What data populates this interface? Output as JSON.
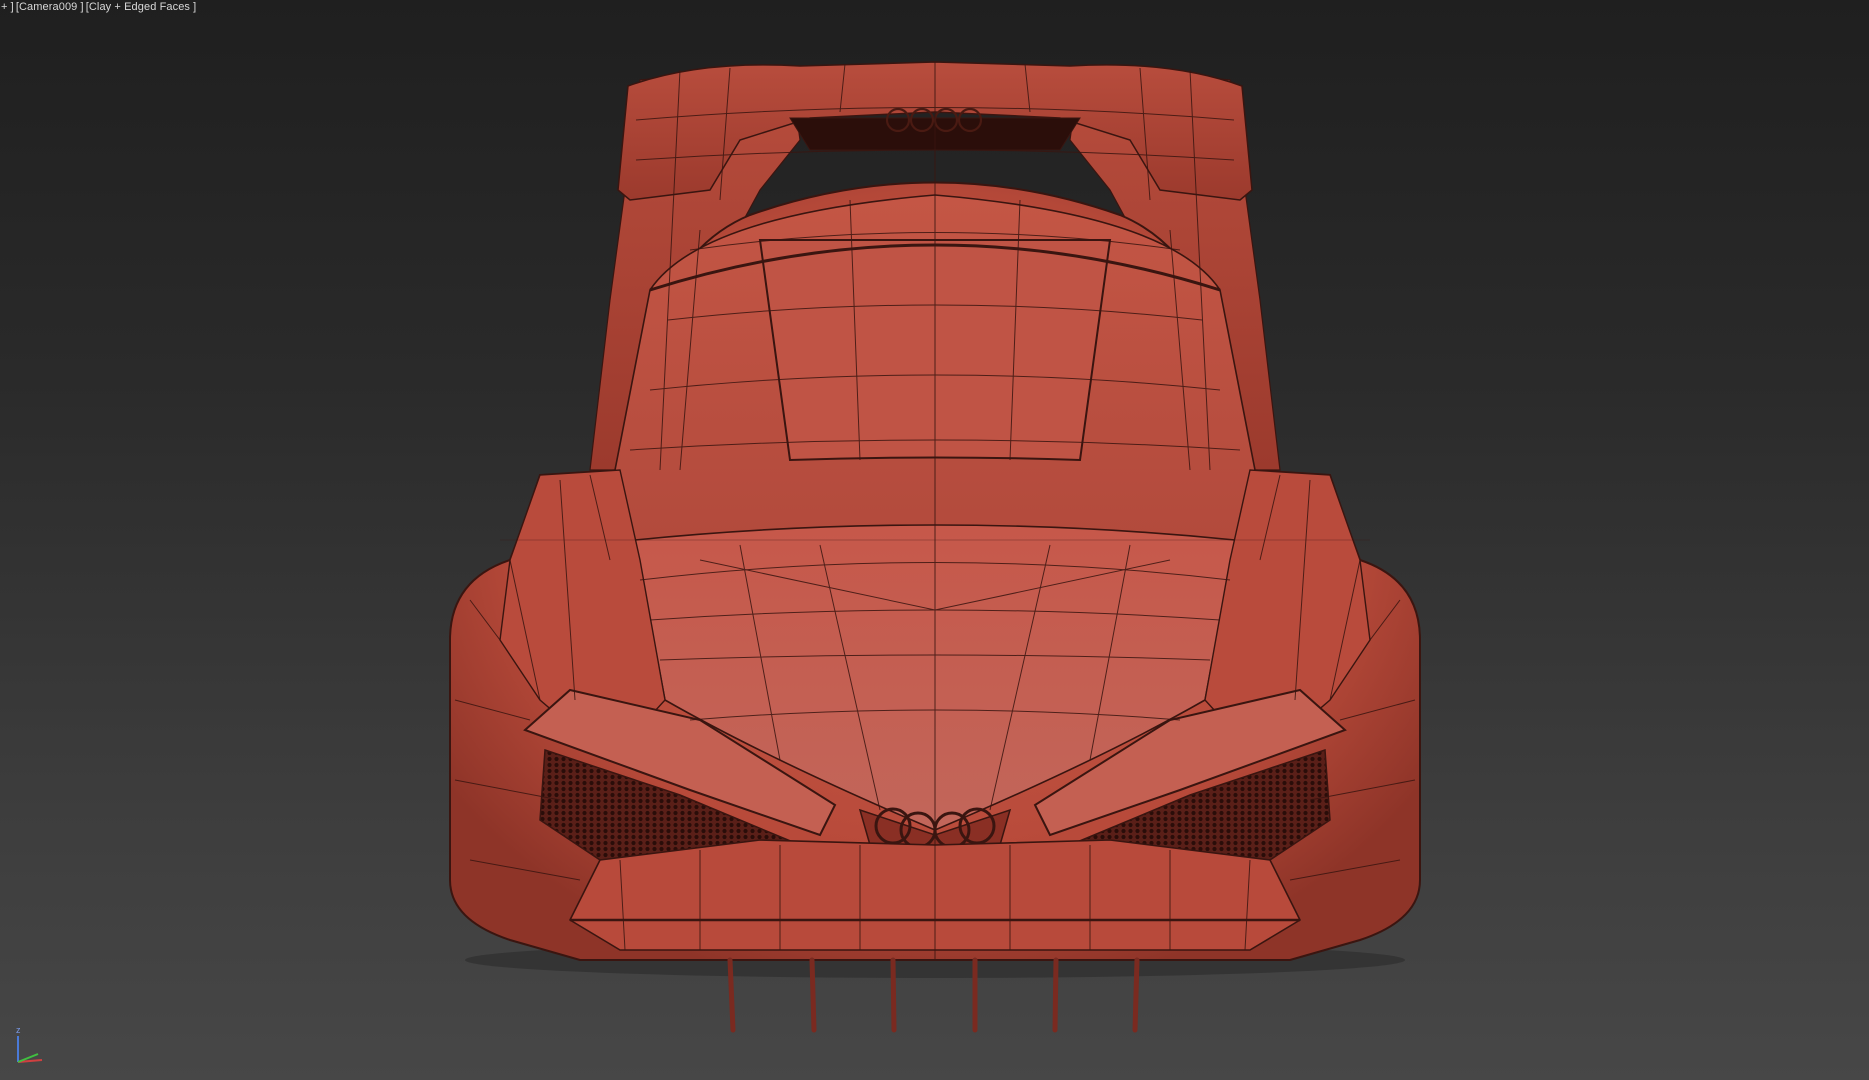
{
  "viewport": {
    "menu_label": "+ ]",
    "camera_label": "[Camera009 ]",
    "shading_label": "[Clay + Edged Faces ]",
    "background_top": "#1f1f1f",
    "background_bottom": "#474747"
  },
  "model": {
    "shading": "clay",
    "clay_color": "#c0503f",
    "edge_color": "#3a1510",
    "icons": [
      "rear-four-rings-emblem-icon",
      "front-four-rings-emblem-icon"
    ]
  },
  "axis_gizmo": {
    "z_label": "z",
    "x_color": "#d04040",
    "y_color": "#40c040",
    "z_color": "#4a7ad8"
  }
}
